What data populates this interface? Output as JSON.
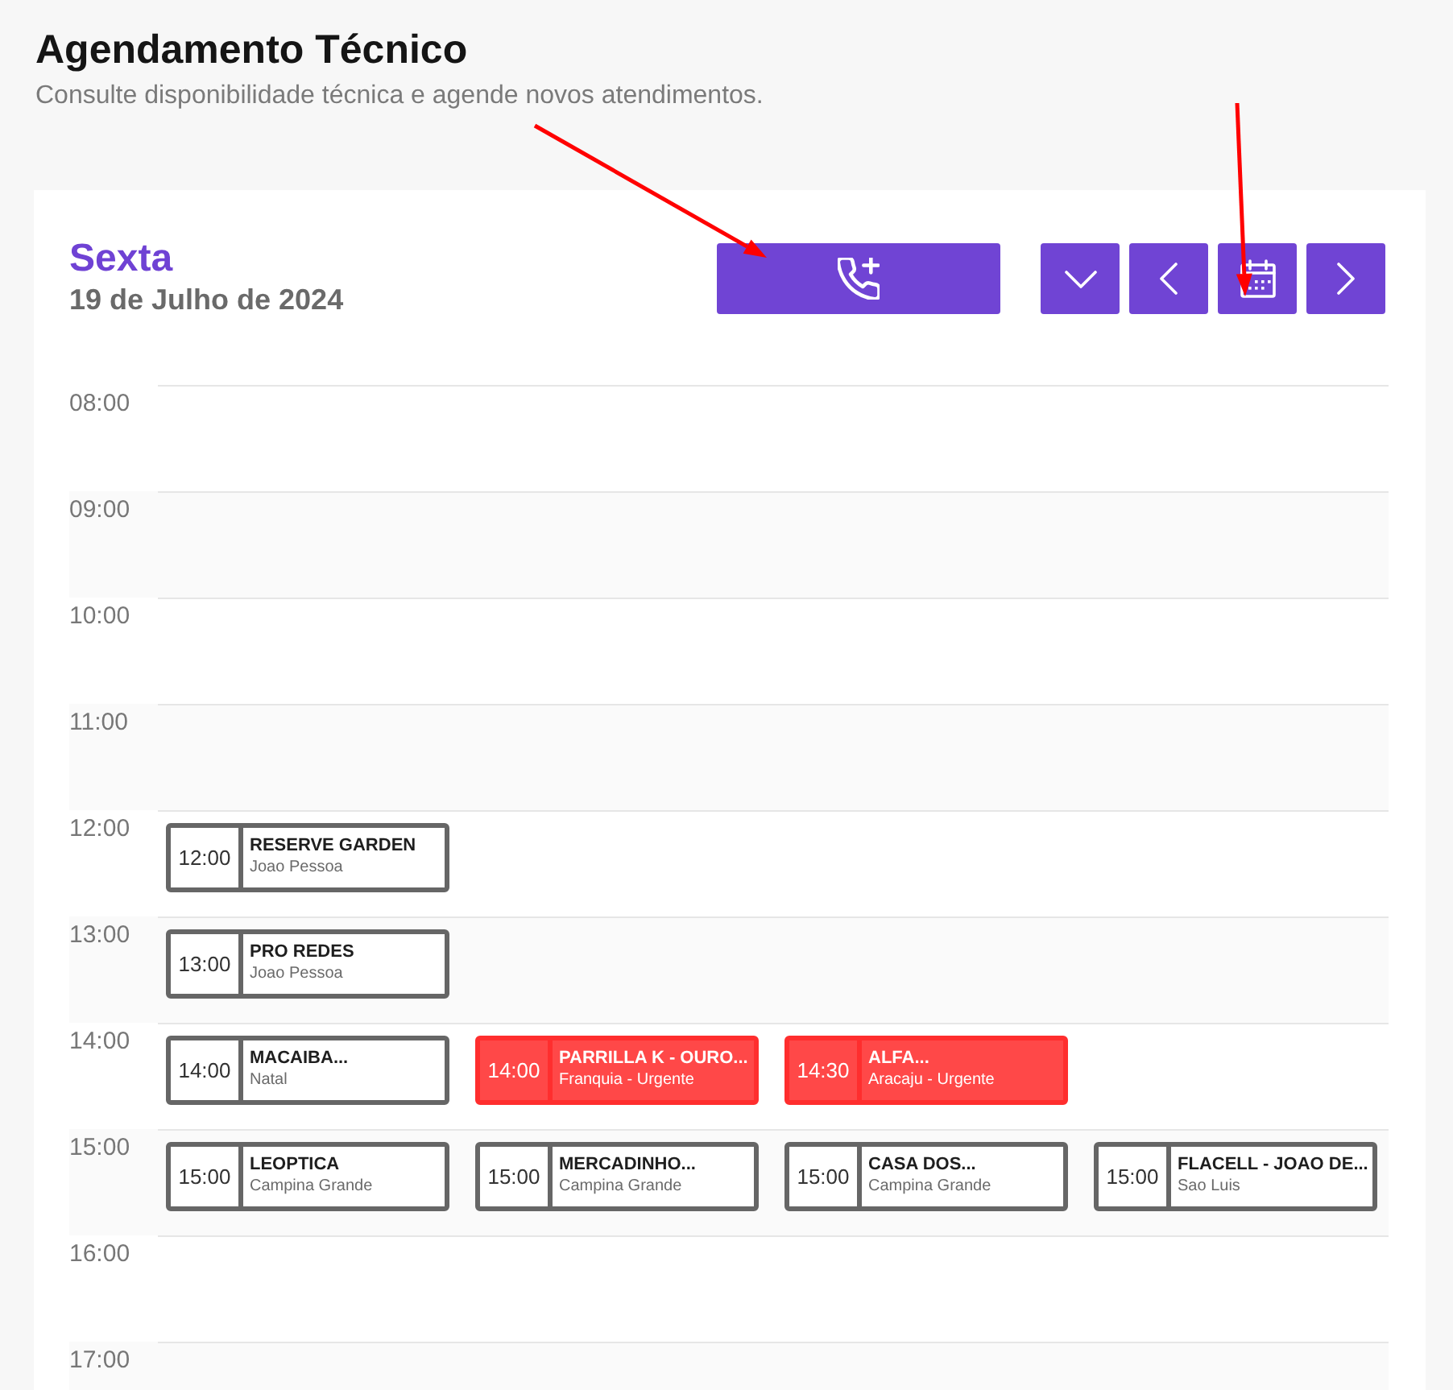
{
  "page": {
    "title": "Agendamento Técnico",
    "subtitle": "Consulte disponibilidade técnica e agende novos atendimentos."
  },
  "day": {
    "weekday": "Sexta",
    "date": "19 de Julho de 2024"
  },
  "toolbar": [
    {
      "kind": "new-call"
    },
    {
      "kind": "dropdown"
    },
    {
      "kind": "previous"
    },
    {
      "kind": "calendar"
    },
    {
      "kind": "next"
    }
  ],
  "schedule": {
    "hours": [
      {
        "time": "08:00"
      },
      {
        "time": "09:00"
      },
      {
        "time": "10:00"
      },
      {
        "time": "11:00"
      },
      {
        "time": "12:00",
        "events": [
          {
            "time": "12:00",
            "title": "RESERVE GARDEN",
            "location": "Joao Pessoa",
            "urgent": false
          }
        ]
      },
      {
        "time": "13:00",
        "events": [
          {
            "time": "13:00",
            "title": "PRO REDES",
            "location": "Joao Pessoa",
            "urgent": false
          }
        ]
      },
      {
        "time": "14:00",
        "events": [
          {
            "time": "14:00",
            "title": "MACAIBA...",
            "location": "Natal",
            "urgent": false
          },
          {
            "time": "14:00",
            "title": "PARRILLA K - OURO...",
            "location": "Franquia - Urgente",
            "urgent": true
          },
          {
            "time": "14:30",
            "title": "ALFA...",
            "location": "Aracaju - Urgente",
            "urgent": true
          }
        ]
      },
      {
        "time": "15:00",
        "events": [
          {
            "time": "15:00",
            "title": "LEOPTICA",
            "location": "Campina Grande",
            "urgent": false
          },
          {
            "time": "15:00",
            "title": "MERCADINHO...",
            "location": "Campina Grande",
            "urgent": false
          },
          {
            "time": "15:00",
            "title": "CASA DOS...",
            "location": "Campina Grande",
            "urgent": false
          },
          {
            "time": "15:00",
            "title": "FLACELL - JOAO DE...",
            "location": "Sao Luis",
            "urgent": false
          }
        ]
      },
      {
        "time": "16:00"
      },
      {
        "time": "17:00"
      }
    ]
  },
  "annotations": [
    {
      "kind": "arrow"
    },
    {
      "kind": "arrow"
    }
  ]
}
